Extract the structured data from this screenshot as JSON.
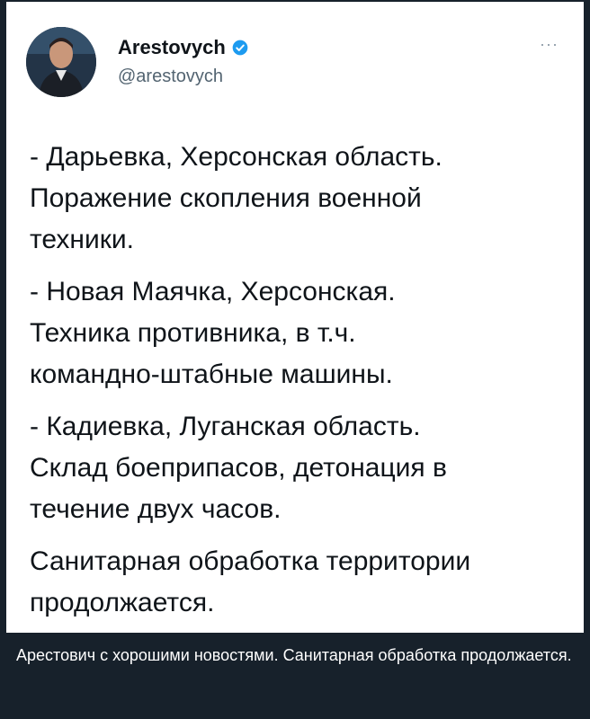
{
  "tweet": {
    "author_name": "Arestovych",
    "handle": "@arestovych",
    "more_label": "···",
    "paragraphs": [
      "- Дарьевка, Херсонская область.\nПоражение скопления военной\nтехники.",
      "- Новая Маячка, Херсонская.\nТехника противника, в т.ч.\nкомандно-штабные машины.",
      "- Кадиевка, Луганская область.\nСклад боеприпасов, детонация в\nтечение двух часов.",
      "Санитарная обработка территории\nпродолжается."
    ]
  },
  "message": {
    "caption": "Арестович с хорошими новостями. Санитарная обработка продолжается."
  },
  "colors": {
    "background": "#17212b",
    "card": "#ffffff",
    "verified": "#1d9bf0"
  },
  "icons": [
    "verified-badge-icon",
    "more-icon"
  ]
}
